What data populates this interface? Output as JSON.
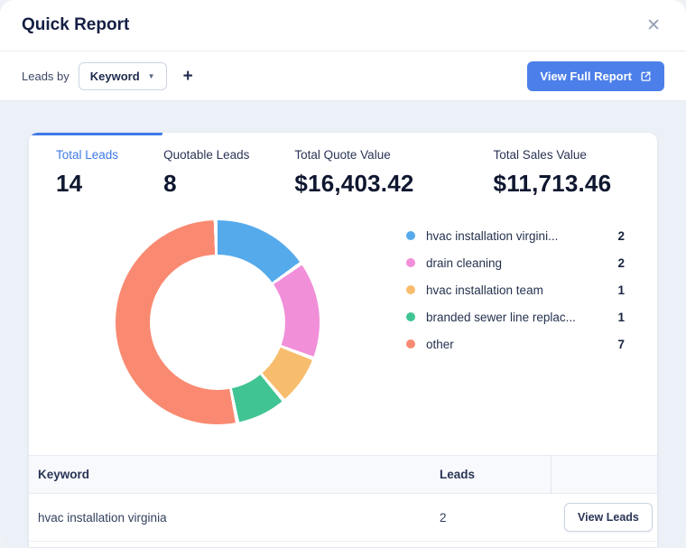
{
  "header": {
    "title": "Quick Report"
  },
  "toolbar": {
    "leads_by_label": "Leads by",
    "keyword_dropdown_value": "Keyword",
    "add_button_label": "+",
    "view_full_report_label": "View Full Report"
  },
  "stats": [
    {
      "label": "Total Leads",
      "value": "14"
    },
    {
      "label": "Quotable Leads",
      "value": "8"
    },
    {
      "label": "Total Quote Value",
      "value": "$16,403.42"
    },
    {
      "label": "Total Sales Value",
      "value": "$11,713.46"
    }
  ],
  "chart_data": {
    "type": "pie",
    "donut": true,
    "categories": [
      "hvac installation virgini...",
      "drain cleaning",
      "hvac installation team",
      "branded sewer line replac...",
      "other"
    ],
    "values": [
      2,
      2,
      1,
      1,
      7
    ],
    "colors": [
      "#55AAEB",
      "#F18FD9",
      "#F7BD6D",
      "#41C493",
      "#F98A71"
    ],
    "legend_position": "right"
  },
  "legend": [
    {
      "label": "hvac installation virgini...",
      "count": "2"
    },
    {
      "label": "drain cleaning",
      "count": "2"
    },
    {
      "label": "hvac installation team",
      "count": "1"
    },
    {
      "label": "branded sewer line replac...",
      "count": "1"
    },
    {
      "label": "other",
      "count": "7"
    }
  ],
  "table": {
    "headers": [
      "Keyword",
      "Leads"
    ],
    "rows": [
      {
        "keyword": "hvac installation virginia",
        "leads": "2",
        "action_label": "View Leads"
      }
    ]
  },
  "colors": {
    "accent_blue": "#3E79E8",
    "button_blue": "#4C7FE9",
    "content_background": "#ECF1F8"
  }
}
